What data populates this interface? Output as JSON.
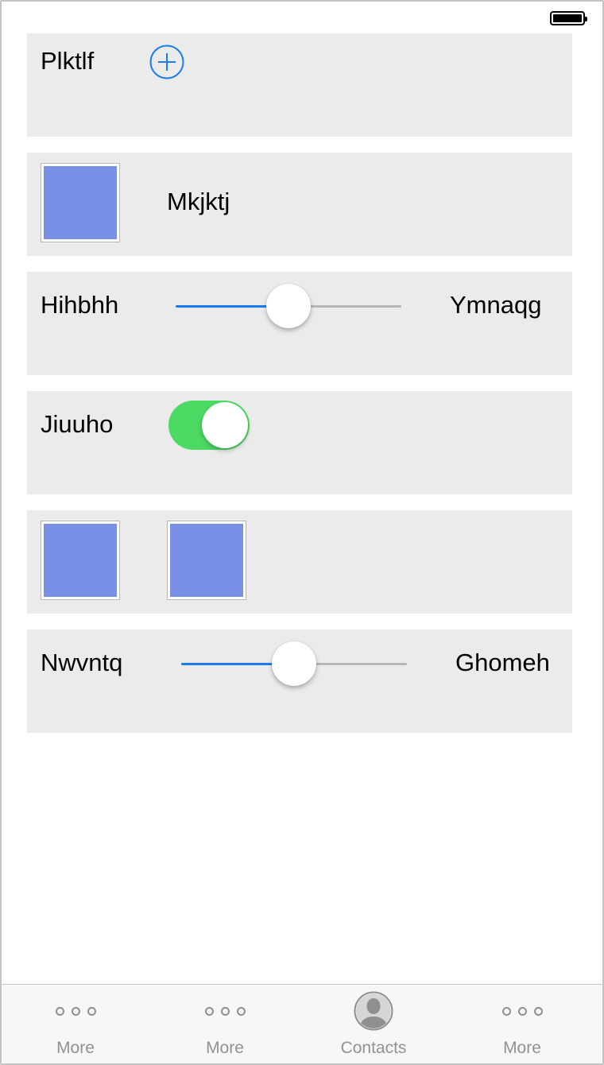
{
  "status_bar": {
    "battery": "full"
  },
  "rows": {
    "row1": {
      "label": "Plktlf",
      "icon": "plus-circle-icon"
    },
    "row2": {
      "label": "Mkjktj"
    },
    "row3": {
      "left_label": "Hihbhh",
      "right_label": "Ymnaqg",
      "slider_value": 0.5
    },
    "row4": {
      "label": "Jiuuho",
      "toggle_on": true
    },
    "row6": {
      "left_label": "Nwvntq",
      "right_label": "Ghomeh",
      "slider_value": 0.5
    }
  },
  "tabbar": {
    "tabs": [
      {
        "label": "More",
        "icon": "more-dots-icon"
      },
      {
        "label": "More",
        "icon": "more-dots-icon"
      },
      {
        "label": "Contacts",
        "icon": "contact-person-icon"
      },
      {
        "label": "More",
        "icon": "more-dots-icon"
      }
    ]
  },
  "colors": {
    "accent": "#1a7cf0",
    "toggle_on": "#4cd964",
    "swatch": "#7a90e6",
    "row_background": "#ebebeb"
  }
}
